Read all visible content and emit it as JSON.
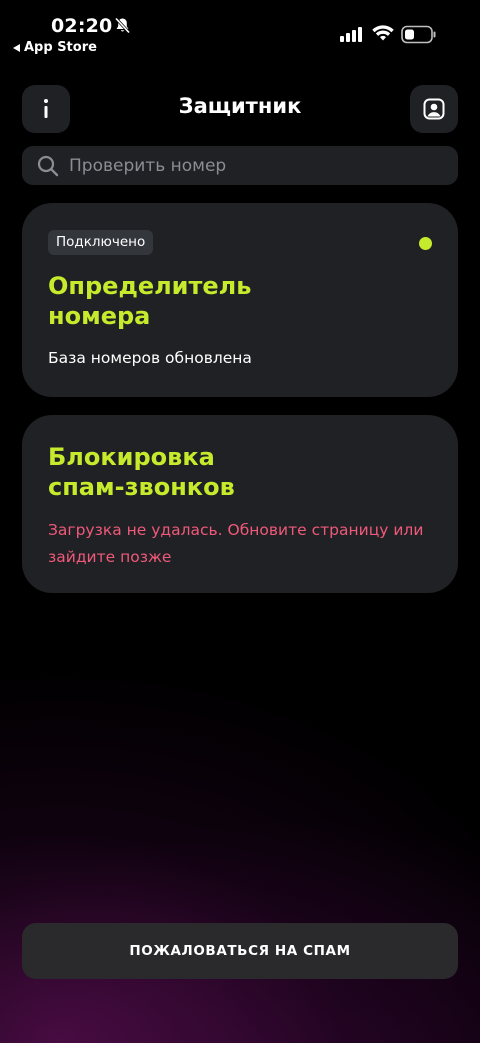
{
  "status_bar": {
    "time": "02:20",
    "back_app": "App Store"
  },
  "header": {
    "title": "Защитник",
    "info_icon": "info-icon",
    "profile_icon": "profile-icon"
  },
  "search": {
    "placeholder": "Проверить номер",
    "value": ""
  },
  "cards": {
    "caller_id": {
      "badge": "Подключено",
      "title": "Определитель\nномера",
      "description": "База номеров обновлена",
      "status_color": "#c6ea2c"
    },
    "spam_block": {
      "title": "Блокировка\nспам-звонков",
      "error": "Загрузка не удалась. Обновите страницу или зайдите позже",
      "error_color": "#f0597a"
    }
  },
  "footer": {
    "report_label": "ПОЖАЛОВАТЬСЯ НА СПАМ"
  },
  "colors": {
    "accent": "#c6ea2c",
    "card_bg": "#1f2124",
    "error": "#f0597a"
  }
}
